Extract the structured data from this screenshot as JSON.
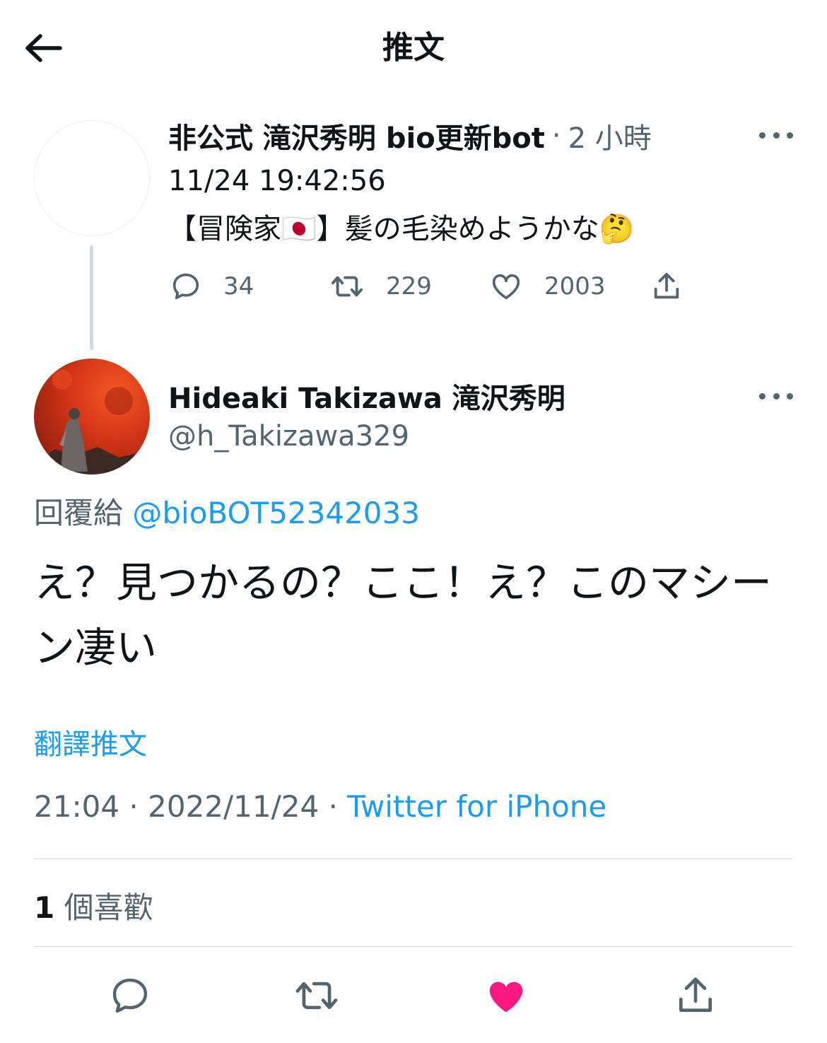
{
  "header": {
    "title": "推文"
  },
  "parent_tweet": {
    "display_name": "非公式 滝沢秀明 bio更新bot",
    "separator": "·",
    "time_ago": "2 小時",
    "line1": "11/24 19:42:56",
    "line2": "【冒険家🇯🇵】髪の毛染めようかな🤔",
    "replies": "34",
    "retweets": "229",
    "likes": "2003"
  },
  "tweet": {
    "display_name": "Hideaki Takizawa 滝沢秀明",
    "handle": "@h_Takizawa329",
    "reply_prefix": "回覆給",
    "reply_to": "@bioBOT52342033",
    "text": "え？見つかるの？ここ！え？このマシーン凄い",
    "translate": "翻譯推文",
    "time": "21:04",
    "date": "2022/11/24",
    "sep": "·",
    "source": "Twitter for iPhone",
    "like_count": "1",
    "like_label": "個喜歡"
  },
  "colors": {
    "text": "#0f1419",
    "secondary": "#536471",
    "link": "#1d9bf0",
    "like_active": "#f91880",
    "divider": "#cfd9de"
  },
  "icons": [
    "back-arrow-icon",
    "more-icon",
    "reply-icon",
    "retweet-icon",
    "heart-icon",
    "share-icon",
    "heart-filled-icon"
  ]
}
